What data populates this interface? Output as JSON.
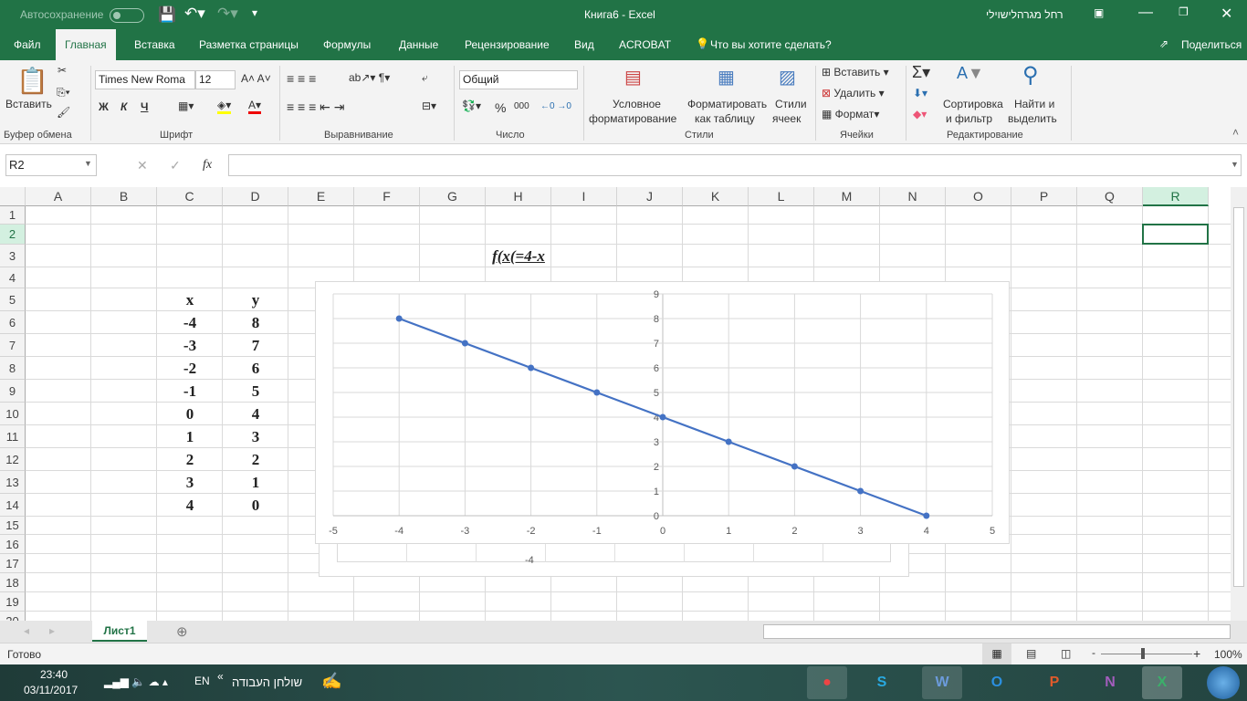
{
  "titlebar": {
    "autosave": "Автосохранение",
    "title": "Книга6  -  Excel",
    "user": "רחל מגרהלישוילי"
  },
  "tabs": [
    "Файл",
    "Главная",
    "Вставка",
    "Разметка страницы",
    "Формулы",
    "Данные",
    "Рецензирование",
    "Вид",
    "ACROBAT"
  ],
  "tell_me": "Что вы хотите сделать?",
  "share": "Поделиться",
  "ribbon": {
    "paste": "Вставить",
    "clipboard": "Буфер обмена",
    "font_name": "Times New Roma",
    "font_size": "12",
    "bold": "Ж",
    "italic": "К",
    "underline": "Ч",
    "font_group": "Шрифт",
    "align_group": "Выравнивание",
    "number_format": "Общий",
    "percent": "%",
    "thousands": "000",
    "number_group": "Число",
    "cond_format_1": "Условное",
    "cond_format_2": "форматирование",
    "format_table_1": "Форматировать",
    "format_table_2": "как таблицу",
    "cell_styles_1": "Стили",
    "cell_styles_2": "ячеек",
    "styles_group": "Стили",
    "insert": "Вставить",
    "delete": "Удалить",
    "format": "Формат",
    "cells_group": "Ячейки",
    "sort_1": "Сортировка",
    "sort_2": "и фильтр",
    "find_1": "Найти и",
    "find_2": "выделить",
    "editing_group": "Редактирование"
  },
  "formula_bar": {
    "name_box": "R2",
    "fx": "fx",
    "formula": ""
  },
  "columns": [
    "A",
    "B",
    "C",
    "D",
    "E",
    "F",
    "G",
    "H",
    "I",
    "J",
    "K",
    "L",
    "M",
    "N",
    "O",
    "P",
    "Q",
    "R"
  ],
  "rows": [
    "1",
    "2",
    "3",
    "4",
    "5",
    "6",
    "7",
    "8",
    "9",
    "10",
    "11",
    "12",
    "13",
    "14",
    "15",
    "16",
    "17",
    "18",
    "19",
    "20"
  ],
  "cells": {
    "H3": "f(x(=4-x",
    "C5": "x",
    "D5": "y",
    "C6": "-4",
    "D6": "8",
    "C7": "-3",
    "D7": "7",
    "C8": "-2",
    "D8": "6",
    "C9": "-1",
    "D9": "5",
    "C10": "0",
    "D10": "4",
    "C11": "1",
    "D11": "3",
    "C12": "2",
    "D12": "2",
    "C13": "3",
    "D13": "1",
    "C14": "4",
    "D14": "0"
  },
  "chart_data": {
    "type": "scatter",
    "title": "",
    "xlabel": "",
    "ylabel": "",
    "xlim": [
      -5,
      5
    ],
    "ylim": [
      0,
      9
    ],
    "grid": true,
    "x": [
      -4,
      -3,
      -2,
      -1,
      0,
      1,
      2,
      3,
      4
    ],
    "series": [
      {
        "name": "y",
        "values": [
          8,
          7,
          6,
          5,
          4,
          3,
          2,
          1,
          0
        ],
        "color": "#4472c4"
      }
    ],
    "xticks": [
      "-5",
      "-4",
      "-3",
      "-2",
      "-1",
      "0",
      "1",
      "2",
      "3",
      "4",
      "5"
    ],
    "yticks": [
      "0",
      "1",
      "2",
      "3",
      "4",
      "5",
      "6",
      "7",
      "8",
      "9"
    ]
  },
  "hidden_chart_label": "-4",
  "sheet_tab": "Лист1",
  "status": {
    "ready": "Готово",
    "zoom": "100%"
  },
  "taskbar": {
    "time": "23:40",
    "date": "03/11/2017",
    "lang": "EN",
    "desktop": "שולחן העבודה",
    "apps": [
      "Chrome",
      "Skype",
      "Word",
      "Outlook",
      "PowerPoint",
      "OneNote",
      "Excel"
    ]
  },
  "colors": {
    "accent": "#217346",
    "series": "#4472c4"
  }
}
